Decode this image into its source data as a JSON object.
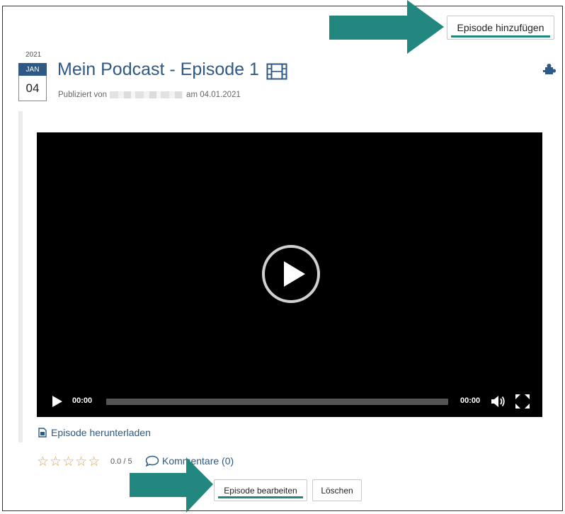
{
  "toolbar": {
    "add_episode_label": "Episode hinzufügen"
  },
  "date": {
    "year": "2021",
    "month": "JAN",
    "day": "04"
  },
  "episode": {
    "title": "Mein Podcast - Episode 1",
    "published_prefix": "Publiziert von",
    "published_suffix": "am 04.01.2021"
  },
  "player": {
    "current_time": "00:00",
    "duration": "00:00"
  },
  "download": {
    "label": "Episode herunterladen"
  },
  "rating": {
    "value": "0.0 / 5",
    "stars_total": 5,
    "stars_filled": 0
  },
  "comments": {
    "label": "Kommentare (0)"
  },
  "actions": {
    "edit_label": "Episode bearbeiten",
    "delete_label": "Löschen"
  },
  "colors": {
    "accent": "#2f5985",
    "annotation": "#21877f",
    "star": "#e9a23b",
    "player_bg": "#000000"
  },
  "icons": [
    "film-icon",
    "puzzle-icon",
    "play-icon",
    "volume-icon",
    "fullscreen-icon",
    "download-file-icon",
    "star-icon",
    "comment-icon"
  ]
}
